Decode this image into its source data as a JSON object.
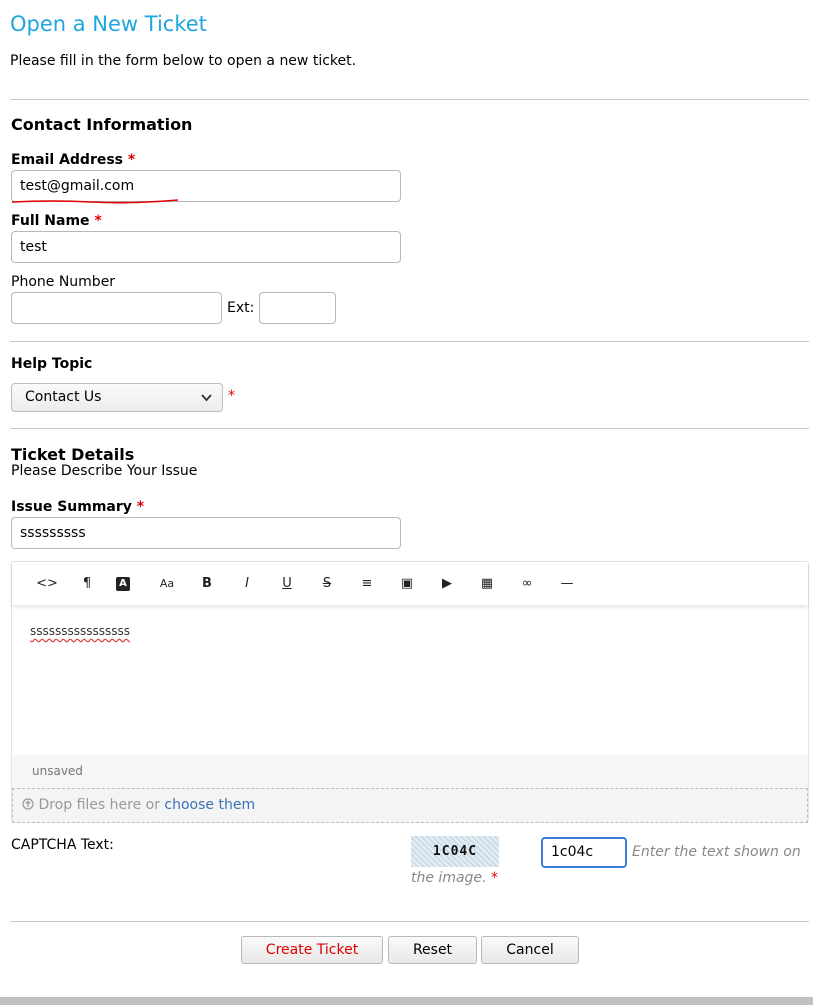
{
  "page": {
    "title": "Open a New Ticket",
    "intro": "Please fill in the form below to open a new ticket."
  },
  "contact": {
    "heading": "Contact Information",
    "email_label": "Email Address",
    "email_value": "test@gmail.com",
    "name_label": "Full Name",
    "name_value": "test",
    "phone_label": "Phone Number",
    "phone_value": "",
    "ext_label": "Ext:",
    "ext_value": "",
    "required_mark": "*"
  },
  "help_topic": {
    "heading": "Help Topic",
    "selected": "Contact Us"
  },
  "ticket": {
    "heading": "Ticket Details",
    "subheading": "Please Describe Your Issue",
    "summary_label": "Issue Summary",
    "summary_value": "sssssssss",
    "body_text": "ssssssssssssssss",
    "status": "unsaved",
    "drop_text": "Drop files here or",
    "drop_link": "choose them"
  },
  "toolbar": {
    "buttons": [
      {
        "name": "code-view-icon",
        "glyph": "<>"
      },
      {
        "name": "paragraph-icon",
        "glyph": "¶"
      },
      {
        "name": "text-color-icon",
        "glyph": "A"
      },
      {
        "name": "font-size-icon",
        "glyph": "Aa"
      },
      {
        "name": "bold-icon",
        "glyph": "B"
      },
      {
        "name": "italic-icon",
        "glyph": "I"
      },
      {
        "name": "underline-icon",
        "glyph": "U"
      },
      {
        "name": "strikethrough-icon",
        "glyph": "S"
      },
      {
        "name": "list-icon",
        "glyph": "≡"
      },
      {
        "name": "image-icon",
        "glyph": "▣"
      },
      {
        "name": "video-icon",
        "glyph": "▶"
      },
      {
        "name": "table-icon",
        "glyph": "▦"
      },
      {
        "name": "link-icon",
        "glyph": "∞"
      },
      {
        "name": "horizontal-rule-icon",
        "glyph": "—"
      }
    ]
  },
  "captcha": {
    "label": "CAPTCHA Text:",
    "image_text": "1C04C",
    "input_value": "1c04c",
    "hint_part1": "Enter the text shown on",
    "hint_part2": "the image."
  },
  "actions": {
    "create": "Create Ticket",
    "reset": "Reset",
    "cancel": "Cancel"
  },
  "colors": {
    "title": "#1fa6dc",
    "required": "#e00000",
    "create_button_text": "#e00000",
    "link": "#3a74b4"
  }
}
